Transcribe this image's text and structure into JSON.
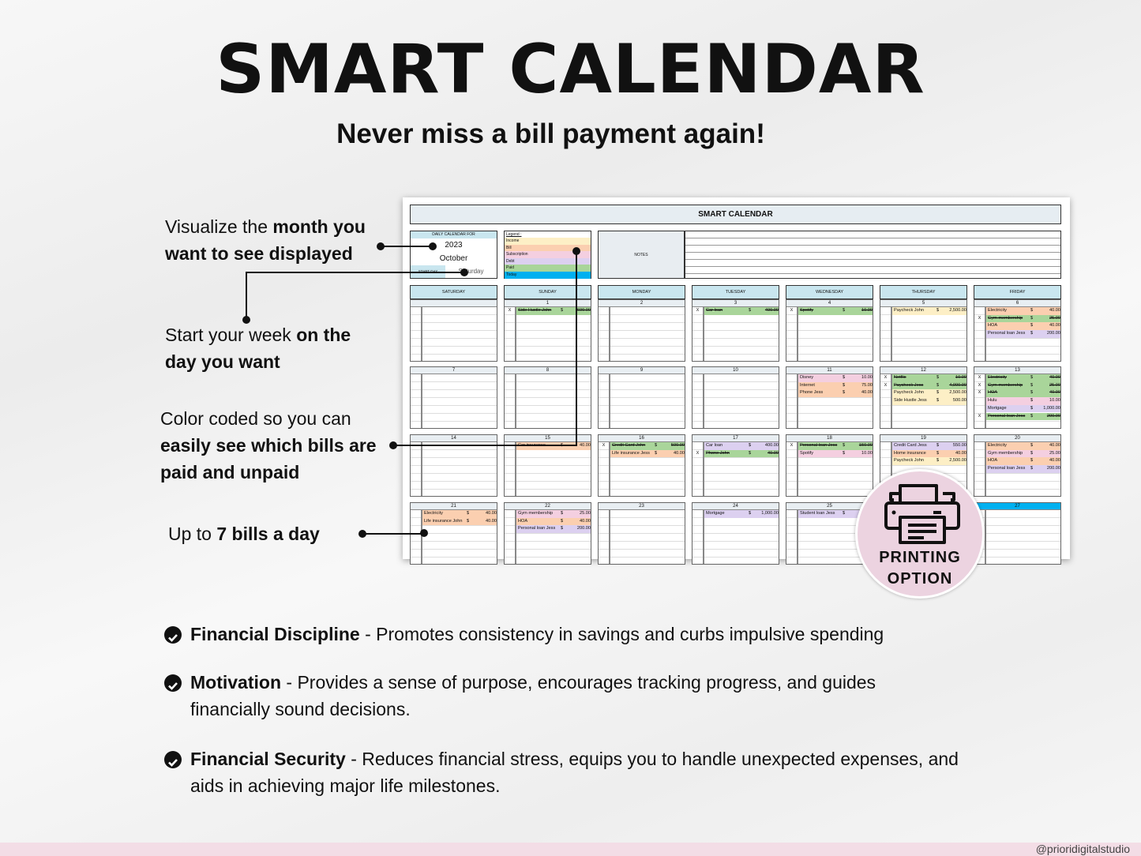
{
  "title": "SMART CALENDAR",
  "subtitle": "Never miss a bill payment again!",
  "annotations": [
    {
      "pre": "Visualize the ",
      "bold": "month you want to see displayed",
      "post": ""
    },
    {
      "pre": "Start your week ",
      "bold": "on  the day you want",
      "post": ""
    },
    {
      "pre": "Color coded so you can ",
      "bold": "easily see which bills are paid and unpaid",
      "post": ""
    },
    {
      "pre": "Up to ",
      "bold": "7 bills a day",
      "post": ""
    }
  ],
  "sheet": {
    "title": "SMART CALENDAR",
    "daily_label": "DAILY CALENDAR FOR",
    "year": "2023",
    "month": "October",
    "start_day_label": "START DAY",
    "start_day": "Saturday",
    "legend_title": "Legend :",
    "legend": [
      {
        "label": "Income",
        "color": "#fdefc6"
      },
      {
        "label": "Bill",
        "color": "#fbcfb0"
      },
      {
        "label": "Subscription",
        "color": "#f4cfe0"
      },
      {
        "label": "Debt",
        "color": "#dcd0f0"
      },
      {
        "label": "Paid",
        "color": "#a9d59a"
      },
      {
        "label": "Today",
        "color": "#00b0f0"
      }
    ],
    "notes_label": "NOTES",
    "days": [
      "SATURDAY",
      "SUNDAY",
      "MONDAY",
      "TUESDAY",
      "WEDNESDAY",
      "THURSDAY",
      "FRIDAY"
    ],
    "weeks": [
      [
        {
          "date": "",
          "e": []
        },
        {
          "date": "1",
          "e": [
            {
              "x": "X",
              "n": "Side Hustle John",
              "a": "600.00",
              "t": "paid"
            }
          ]
        },
        {
          "date": "2",
          "e": []
        },
        {
          "date": "3",
          "e": [
            {
              "x": "X",
              "n": "Car loan",
              "a": "400.00",
              "t": "paid"
            }
          ]
        },
        {
          "date": "4",
          "e": [
            {
              "x": "X",
              "n": "Spotify",
              "a": "10.00",
              "t": "paid"
            }
          ]
        },
        {
          "date": "5",
          "e": [
            {
              "x": "",
              "n": "Paycheck John",
              "a": "2,500.00",
              "t": "income"
            }
          ]
        },
        {
          "date": "6",
          "e": [
            {
              "x": "",
              "n": "Electricity",
              "a": "40.00",
              "t": "bill"
            },
            {
              "x": "X",
              "n": "Gym membership",
              "a": "25.00",
              "t": "paid"
            },
            {
              "x": "",
              "n": "HOA",
              "a": "40.00",
              "t": "bill"
            },
            {
              "x": "",
              "n": "Personal loan Jess",
              "a": "200.00",
              "t": "debt"
            }
          ]
        }
      ],
      [
        {
          "date": "7",
          "e": []
        },
        {
          "date": "8",
          "e": []
        },
        {
          "date": "9",
          "e": []
        },
        {
          "date": "10",
          "e": []
        },
        {
          "date": "11",
          "e": [
            {
              "x": "",
              "n": "Disney",
              "a": "10.00",
              "t": "subscription"
            },
            {
              "x": "",
              "n": "Internet",
              "a": "75.00",
              "t": "bill"
            },
            {
              "x": "",
              "n": "Phone Jess",
              "a": "40.00",
              "t": "bill"
            }
          ]
        },
        {
          "date": "12",
          "e": [
            {
              "x": "X",
              "n": "Netflix",
              "a": "10.00",
              "t": "paid"
            },
            {
              "x": "X",
              "n": "Paycheck Jess",
              "a": "4,000.00",
              "t": "paid"
            },
            {
              "x": "",
              "n": "Paycheck John",
              "a": "2,500.00",
              "t": "income"
            },
            {
              "x": "",
              "n": "Side Hustle Jess",
              "a": "500.00",
              "t": "income"
            }
          ]
        },
        {
          "date": "13",
          "e": [
            {
              "x": "X",
              "n": "Electricity",
              "a": "40.00",
              "t": "paid"
            },
            {
              "x": "X",
              "n": "Gym membership",
              "a": "25.00",
              "t": "paid"
            },
            {
              "x": "X",
              "n": "HOA",
              "a": "40.00",
              "t": "paid"
            },
            {
              "x": "",
              "n": "Hulu",
              "a": "10.00",
              "t": "subscription"
            },
            {
              "x": "",
              "n": "Mortgage",
              "a": "1,000.00",
              "t": "debt"
            },
            {
              "x": "X",
              "n": "Personal loan Jess",
              "a": "200.00",
              "t": "paid"
            }
          ]
        }
      ],
      [
        {
          "date": "14",
          "e": []
        },
        {
          "date": "15",
          "e": [
            {
              "x": "",
              "n": "Car insurance",
              "a": "40.00",
              "t": "bill"
            }
          ]
        },
        {
          "date": "16",
          "e": [
            {
              "x": "X",
              "n": "Credit Card John",
              "a": "500.00",
              "t": "paid"
            },
            {
              "x": "",
              "n": "Life insurance Jess",
              "a": "40.00",
              "t": "bill"
            }
          ]
        },
        {
          "date": "17",
          "e": [
            {
              "x": "",
              "n": "Car loan",
              "a": "400.00",
              "t": "debt"
            },
            {
              "x": "X",
              "n": "Phone John",
              "a": "40.00",
              "t": "paid"
            }
          ]
        },
        {
          "date": "18",
          "e": [
            {
              "x": "X",
              "n": "Personal loan Jess",
              "a": "150.00",
              "t": "paid"
            },
            {
              "x": "",
              "n": "Spotify",
              "a": "10.00",
              "t": "subscription"
            }
          ]
        },
        {
          "date": "19",
          "e": [
            {
              "x": "",
              "n": "Credit Card Jess",
              "a": "550.00",
              "t": "debt"
            },
            {
              "x": "",
              "n": "Home insurance",
              "a": "40.00",
              "t": "bill"
            },
            {
              "x": "",
              "n": "Paycheck John",
              "a": "2,500.00",
              "t": "income"
            }
          ]
        },
        {
          "date": "20",
          "e": [
            {
              "x": "",
              "n": "Electricity",
              "a": "40.00",
              "t": "bill"
            },
            {
              "x": "",
              "n": "Gym membership",
              "a": "25.00",
              "t": "subscription"
            },
            {
              "x": "",
              "n": "HOA",
              "a": "40.00",
              "t": "bill"
            },
            {
              "x": "",
              "n": "Personal loan Jess",
              "a": "200.00",
              "t": "debt"
            }
          ]
        }
      ],
      [
        {
          "date": "21",
          "e": [
            {
              "x": "",
              "n": "Electricity",
              "a": "40.00",
              "t": "bill"
            },
            {
              "x": "",
              "n": "Life insurance John",
              "a": "40.00",
              "t": "bill"
            }
          ]
        },
        {
          "date": "22",
          "e": [
            {
              "x": "",
              "n": "Gym membership",
              "a": "25.00",
              "t": "subscription"
            },
            {
              "x": "",
              "n": "HOA",
              "a": "40.00",
              "t": "bill"
            },
            {
              "x": "",
              "n": "Personal loan Jess",
              "a": "200.00",
              "t": "debt"
            }
          ]
        },
        {
          "date": "23",
          "e": []
        },
        {
          "date": "24",
          "e": [
            {
              "x": "",
              "n": "Mortgage",
              "a": "1,000.00",
              "t": "debt"
            }
          ]
        },
        {
          "date": "25",
          "e": [
            {
              "x": "",
              "n": "Student loan Jess",
              "a": "",
              "t": "debt"
            }
          ]
        },
        {
          "date": "",
          "e": []
        },
        {
          "date": "27",
          "today": true,
          "e": []
        }
      ]
    ],
    "currency": "$",
    "type_colors": {
      "income": "#fdefc6",
      "bill": "#fbcfb0",
      "subscription": "#f4cfe0",
      "debt": "#dcd0f0",
      "paid": "#a9d59a"
    }
  },
  "badge": {
    "line1": "PRINTING",
    "line2": "OPTION",
    "icon": "printer-icon"
  },
  "bullets": [
    {
      "bold": "Financial Discipline",
      "text": " - Promotes consistency in savings and curbs impulsive spending"
    },
    {
      "bold": "Motivation",
      "text": " - Provides a sense of purpose, encourages tracking progress, and guides financially sound decisions."
    },
    {
      "bold": "Financial Security",
      "text": " - Reduces financial stress, equips you to handle unexpected expenses, and aids in achieving major life milestones."
    }
  ],
  "footer": {
    "handle": "@prioridigitalstudio"
  }
}
